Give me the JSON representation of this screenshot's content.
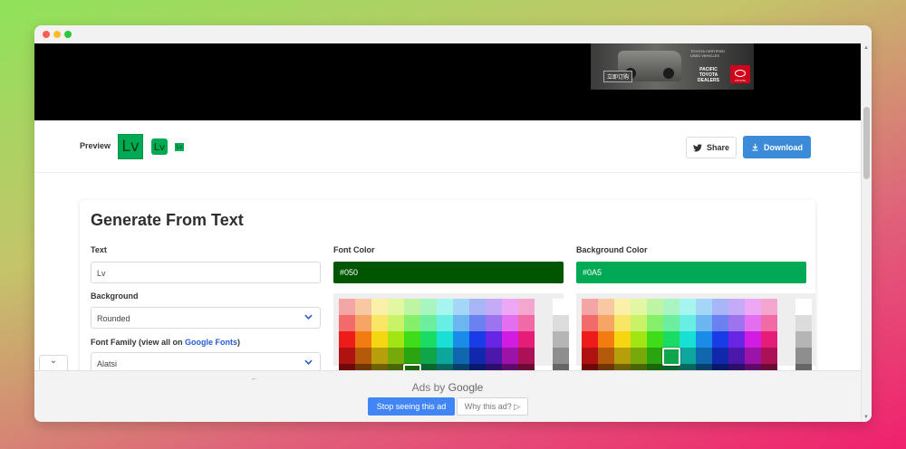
{
  "ad_banner": {
    "cta": "立即订购",
    "tagline": "TOYOTA CERTIFIED USED VEHICLES",
    "dealer": "PACIFIC TOYOTA DEALERS",
    "brand": "TOYOTA"
  },
  "preview": {
    "label": "Preview",
    "logo_text": "Lv",
    "share_label": "Share",
    "download_label": "Download"
  },
  "generator": {
    "title": "Generate From Text",
    "text_label": "Text",
    "text_value": "Lv",
    "background_label": "Background",
    "background_value": "Rounded",
    "font_family_label": "Font Family (view all on ",
    "font_family_link": "Google Fonts",
    "font_family_suffix": ")",
    "font_family_value": "Alatsi",
    "font_color_label": "Font Color",
    "font_color_value": "#050",
    "background_color_label": "Background Color",
    "background_color_value": "#0A5"
  },
  "colors": {
    "font_color": "#005500",
    "background_color": "#00aa55",
    "accent": "#3b8bd9",
    "ad_button": "#4285f4"
  },
  "palette": {
    "rows": [
      [
        "#f4a5a5",
        "#f7c8a2",
        "#fbf0a8",
        "#e2f7a2",
        "#bdf5a5",
        "#a8f5c2",
        "#a6f5ee",
        "#a6d6f7",
        "#a8b6f7",
        "#c4aaf7",
        "#eda8f5",
        "#f5a6cf"
      ],
      [
        "#f36a6a",
        "#f6a565",
        "#f9e667",
        "#c9f266",
        "#85ee6b",
        "#6cee9f",
        "#69eee6",
        "#6bb5f1",
        "#6b81f0",
        "#9d73f0",
        "#e36ef0",
        "#f06aa6"
      ],
      [
        "#ee1b1b",
        "#f27c12",
        "#f5d612",
        "#a2e414",
        "#3fdc1a",
        "#1adc65",
        "#18e0d4",
        "#1a8ce8",
        "#1a3ce6",
        "#6826e4",
        "#d11de2",
        "#e51c78"
      ],
      [
        "#b01111",
        "#b45a0a",
        "#b69f0a",
        "#77a90b",
        "#2aa50f",
        "#0fa54a",
        "#0da79e",
        "#0f67ae",
        "#0f28ac",
        "#4a18aa",
        "#9b13a9",
        "#ac1157"
      ],
      [
        "#6e0a0a",
        "#6e3606",
        "#706106",
        "#486806",
        "#186608",
        "#08662c",
        "#076862",
        "#08406c",
        "#08186a",
        "#2d0e6a",
        "#600b69",
        "#6b0a35"
      ]
    ],
    "grays": [
      "#ffffff",
      "#dcdcdc",
      "#b5b5b5",
      "#8e8e8e",
      "#666666"
    ]
  },
  "ads": {
    "back_arrow": "←",
    "ads_by_prefix": "Ads by ",
    "ads_by_brand": "Google",
    "stop_label": "Stop seeing this ad",
    "why_label": "Why this ad? ▷"
  },
  "collapse_icon": "⌄"
}
